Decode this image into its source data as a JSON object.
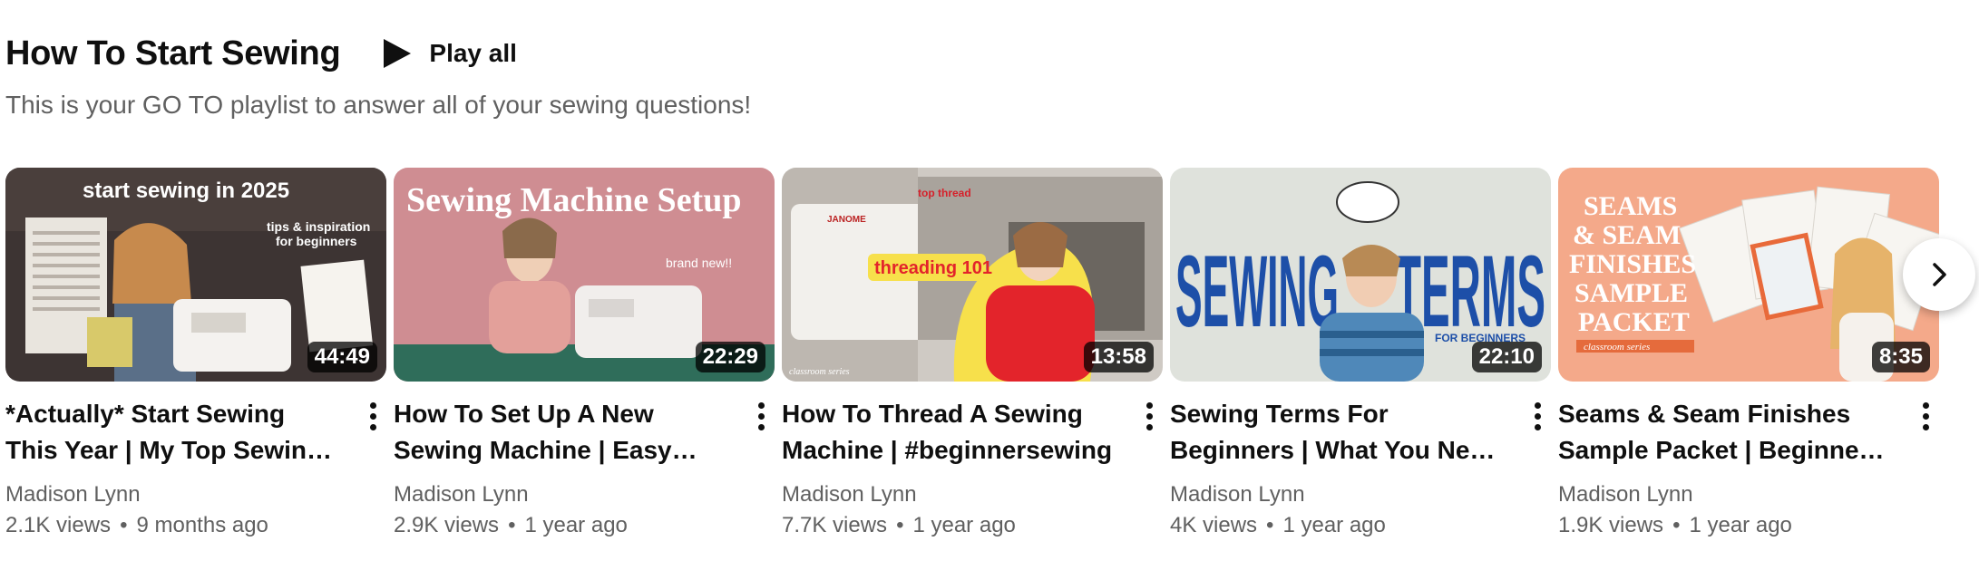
{
  "playlist": {
    "title": "How To Start Sewing",
    "play_all_label": "Play all",
    "description": "This is your GO TO playlist to answer all of your sewing questions!"
  },
  "videos": [
    {
      "title": "*Actually* Start Sewing This Year | My Top Sewing Tips For Beginners",
      "duration": "44:49",
      "channel": "Madison Lynn",
      "views": "2.1K views",
      "age": "9 months ago",
      "thumb_text": [
        "start sewing in 2025",
        "tips & inspiration",
        "for beginners"
      ]
    },
    {
      "title": "How To Set Up A New Sewing Machine | Easy Beginner Tutorial",
      "duration": "22:29",
      "channel": "Madison Lynn",
      "views": "2.9K views",
      "age": "1 year ago",
      "thumb_text": [
        "Sewing Machine Setup",
        "brand new!!"
      ]
    },
    {
      "title": "How To Thread A Sewing Machine | #beginnersewing",
      "duration": "13:58",
      "channel": "Madison Lynn",
      "views": "7.7K views",
      "age": "1 year ago",
      "thumb_text": [
        "threading 101",
        "top thread",
        "JANOME",
        "classroom series"
      ]
    },
    {
      "title": "Sewing Terms For Beginners | What You Need To Know To Start Sewing",
      "duration": "22:10",
      "channel": "Madison Lynn",
      "views": "4K views",
      "age": "1 year ago",
      "thumb_text": [
        "SEWING",
        "TERMS",
        "FOR BEGINNERS"
      ]
    },
    {
      "title": "Seams & Seam Finishes Sample Packet | Beginner Sewing",
      "duration": "8:35",
      "channel": "Madison Lynn",
      "views": "1.9K views",
      "age": "1 year ago",
      "thumb_text": [
        "SEAMS",
        "& SEAM",
        "FINISHES",
        "SAMPLE",
        "PACKET",
        "classroom series"
      ]
    }
  ],
  "icons": {
    "play": "play-icon",
    "more": "more-vert-icon",
    "next": "chevron-right-icon"
  }
}
